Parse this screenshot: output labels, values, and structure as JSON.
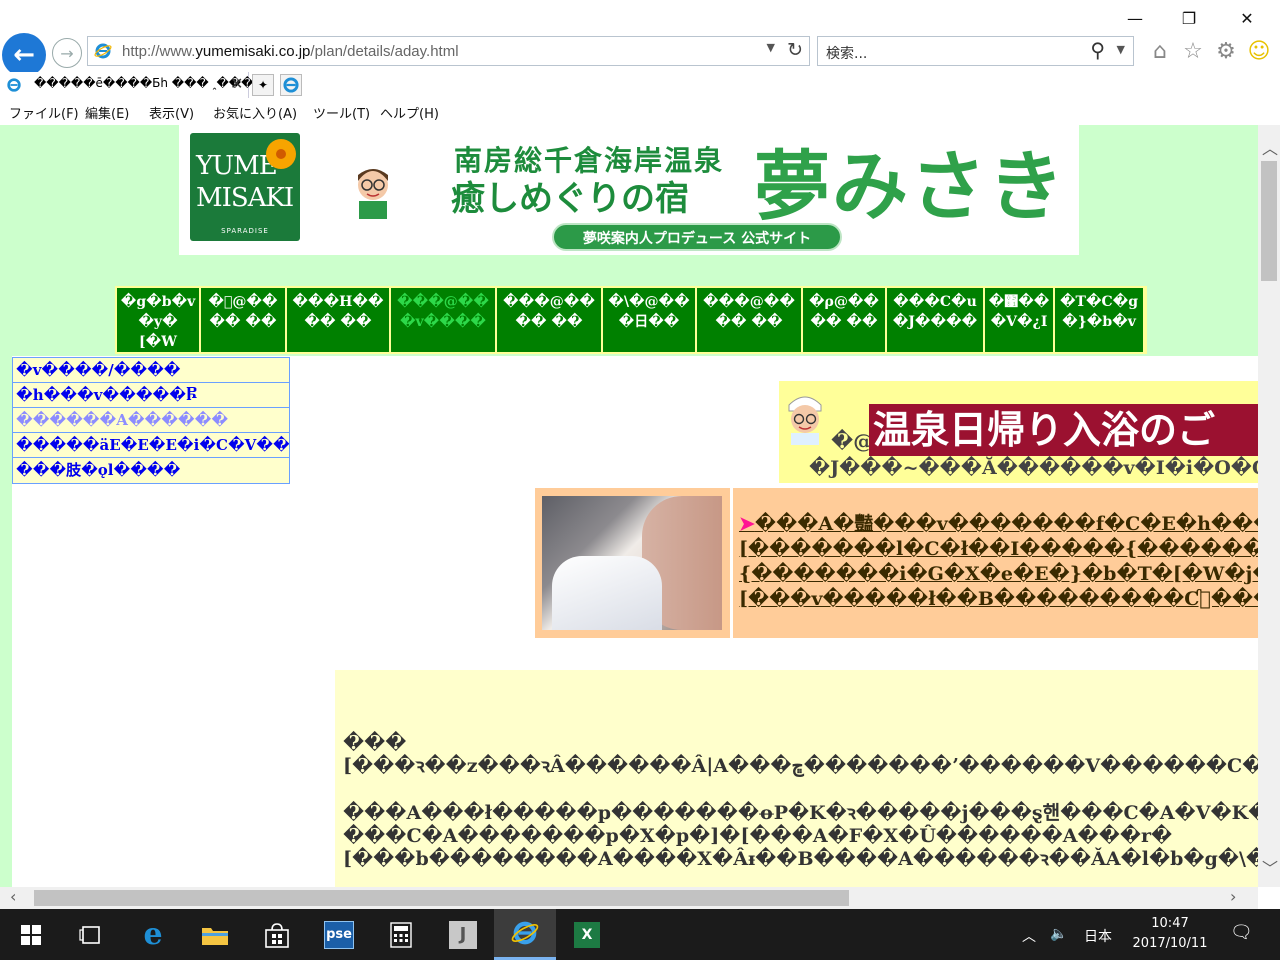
{
  "browser": {
    "url_prefix": "http://www.",
    "url_domain": "yumemisaki.co.jp",
    "url_path": "/plan/details/aday.html",
    "search_placeholder": "検索...",
    "tab_title": "�����ē����Ƃh ��� ꞈ���",
    "new_tab_icon": "new-tab-icon",
    "window_controls": [
      "minimize",
      "restore",
      "close"
    ]
  },
  "menu": {
    "items": [
      "ファイル(F)",
      "編集(E)",
      "表示(V)",
      "お気に入り(A)",
      "ツール(T)",
      "ヘルプ(H)"
    ]
  },
  "header": {
    "logo_line1": "YUME",
    "logo_line2": "MISAKI",
    "logo_sub": "SPARADISE",
    "line1": "南房総千倉海岸温泉",
    "line2": "癒しめぐりの宿",
    "big_title": "夢みさき",
    "pill": "夢咲案内人プロデュース 公式サイト"
  },
  "nav": {
    "items": [
      {
        "label": "�g�b�v\n�y�\n[�W",
        "width": 82,
        "highlight": false
      },
      {
        "label": "�ꨩ@��\n�� ��",
        "width": 84,
        "highlight": false
      },
      {
        "label": "���H��\n�� ��",
        "width": 102,
        "highlight": false
      },
      {
        "label": "���@��\n�v����",
        "width": 104,
        "highlight": true
      },
      {
        "label": "���@��\n�� ��",
        "width": 104,
        "highlight": false
      },
      {
        "label": "�\\�@��\n�日��",
        "width": 92,
        "highlight": false
      },
      {
        "label": "���@��\n�� ��",
        "width": 104,
        "highlight": false
      },
      {
        "label": "�ρ@��\n�� ��",
        "width": 82,
        "highlight": false
      },
      {
        "label": "���C�u\n�J����",
        "width": 96,
        "highlight": false
      },
      {
        "label": "�΁��\n�V�¿I",
        "width": 68,
        "highlight": false
      },
      {
        "label": "�T�C�g\n�}�b�v",
        "width": 88,
        "highlight": false
      }
    ]
  },
  "sidebar": {
    "items": [
      {
        "label": "�v����/����",
        "visited": false
      },
      {
        "label": "�h���v�����Ⴜ",
        "visited": false
      },
      {
        "label": "������A������",
        "visited": true
      },
      {
        "label": "�����ӓE�E�E�i�C�V��!",
        "visited": false
      },
      {
        "label": "���肢�ǫl����",
        "visited": false
      }
    ]
  },
  "banner": {
    "at": "�@",
    "title": "温泉日帰り入浴のご",
    "subtitle": "�J���~���Ă������v�I�i�O�O"
  },
  "links": {
    "arrow": "➤",
    "lines": [
      "���A�豔���v�������f�C�E�h����",
      "[�������l�C�ł��I�����{������",
      "{�������i�G�X�e�E�}�b�T�[�W�j��",
      "[���v�����ł��B���������Ƈ⃞���"
    ]
  },
  "main": {
    "lines": [
      "���",
      "[���ꝛ��z���ꝛÂ������Â|A���ڇ�������ʼ������V������C�y�ꝛ�����p�",
      "",
      "���A���ł�����p�������ꝋP�K�ꝛ�����j���ȿ핸���C�A�V�K�℃�",
      "���C�A�������p�X�p�]�[���A�F�X�Û������A���r�",
      "[���b��������A����X�Âᵻ��B����A������ꝛ��ǍA�l�b�g�\\���qq�"
    ]
  },
  "taskbar": {
    "apps": [
      "start",
      "task-view",
      "edge",
      "file-explorer",
      "store",
      "pse",
      "calculator",
      "j-app",
      "internet-explorer",
      "excel"
    ],
    "active": "internet-explorer",
    "ime": "日本",
    "time": "10:47",
    "date": "2017/10/11"
  }
}
